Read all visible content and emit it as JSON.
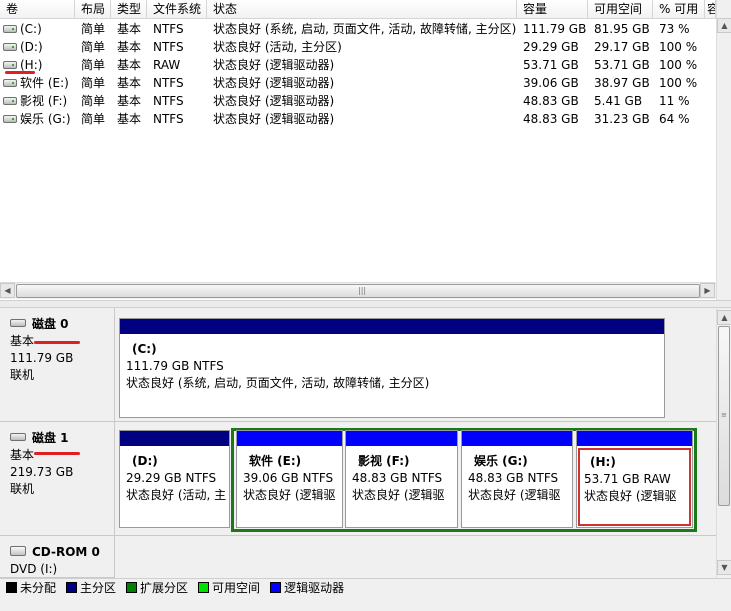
{
  "columns": [
    "卷",
    "布局",
    "类型",
    "文件系统",
    "状态",
    "容量",
    "可用空间",
    "% 可用",
    "容"
  ],
  "volumes": [
    {
      "name": "(C:)",
      "layout": "简单",
      "type": "基本",
      "fs": "NTFS",
      "status": "状态良好 (系统, 启动, 页面文件, 活动, 故障转储, 主分区)",
      "capacity": "111.79 GB",
      "free": "81.95 GB",
      "pct": "73 %"
    },
    {
      "name": "(D:)",
      "layout": "简单",
      "type": "基本",
      "fs": "NTFS",
      "status": "状态良好 (活动, 主分区)",
      "capacity": "29.29 GB",
      "free": "29.17 GB",
      "pct": "100 %"
    },
    {
      "name": "(H:)",
      "layout": "简单",
      "type": "基本",
      "fs": "RAW",
      "status": "状态良好 (逻辑驱动器)",
      "capacity": "53.71 GB",
      "free": "53.71 GB",
      "pct": "100 %"
    },
    {
      "name": "软件 (E:)",
      "layout": "简单",
      "type": "基本",
      "fs": "NTFS",
      "status": "状态良好 (逻辑驱动器)",
      "capacity": "39.06 GB",
      "free": "38.97 GB",
      "pct": "100 %"
    },
    {
      "name": "影视 (F:)",
      "layout": "简单",
      "type": "基本",
      "fs": "NTFS",
      "status": "状态良好 (逻辑驱动器)",
      "capacity": "48.83 GB",
      "free": "5.41 GB",
      "pct": "11 %"
    },
    {
      "name": "娱乐 (G:)",
      "layout": "简单",
      "type": "基本",
      "fs": "NTFS",
      "status": "状态良好 (逻辑驱动器)",
      "capacity": "48.83 GB",
      "free": "31.23 GB",
      "pct": "64 %"
    }
  ],
  "disks": {
    "disk0": {
      "title": "磁盘 0",
      "type": "基本",
      "size": "111.79 GB",
      "state": "联机",
      "partitions": [
        {
          "name": "(C:)",
          "size": "111.79 GB NTFS",
          "status": "状态良好 (系统, 启动, 页面文件, 活动, 故障转储, 主分区)"
        }
      ]
    },
    "disk1": {
      "title": "磁盘 1",
      "type": "基本",
      "size": "219.73 GB",
      "state": "联机",
      "partitions": [
        {
          "name": "(D:)",
          "size": "29.29 GB NTFS",
          "status": "状态良好 (活动, 主"
        },
        {
          "name": "软件  (E:)",
          "size": "39.06 GB NTFS",
          "status": "状态良好 (逻辑驱"
        },
        {
          "name": "影视  (F:)",
          "size": "48.83 GB NTFS",
          "status": "状态良好 (逻辑驱"
        },
        {
          "name": "娱乐  (G:)",
          "size": "48.83 GB NTFS",
          "status": "状态良好 (逻辑驱"
        },
        {
          "name": "(H:)",
          "size": "53.71 GB RAW",
          "status": "状态良好 (逻辑驱"
        }
      ]
    },
    "cdrom0": {
      "title": "CD-ROM 0",
      "drive": "DVD (I:)"
    }
  },
  "legend": [
    {
      "label": "未分配",
      "color": "#000000"
    },
    {
      "label": "主分区",
      "color": "#000080"
    },
    {
      "label": "扩展分区",
      "color": "#008000"
    },
    {
      "label": "可用空间",
      "color": "#00e000"
    },
    {
      "label": "逻辑驱动器",
      "color": "#0000ff"
    }
  ],
  "colors": {
    "primary_bar": "#000080",
    "logical_bar": "#0000ff",
    "extended_border": "#1a7a1a",
    "highlight_red": "#d03030"
  }
}
